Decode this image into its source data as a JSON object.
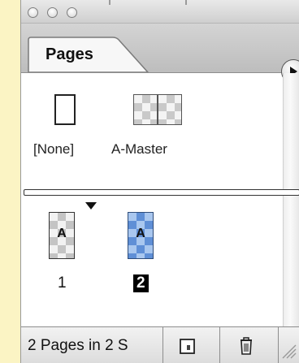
{
  "panel": {
    "tab_label": "Pages"
  },
  "masters": [
    {
      "label": "[None]",
      "icon": "blank-page-icon"
    },
    {
      "label": "A-Master",
      "icon": "master-spread-icon"
    }
  ],
  "pages": [
    {
      "number": "1",
      "master_prefix": "A",
      "selected": false,
      "current": true
    },
    {
      "number": "2",
      "master_prefix": "A",
      "selected": true,
      "current": false
    }
  ],
  "status": {
    "text": "2 Pages in 2 S"
  },
  "icons": {
    "panel_menu": "panel-menu-arrow-icon",
    "new_page": "new-page-icon",
    "delete": "trash-icon",
    "resize": "resize-grip-icon"
  },
  "colors": {
    "background": "#fbf4c4",
    "selection": "#5f8fd6"
  }
}
